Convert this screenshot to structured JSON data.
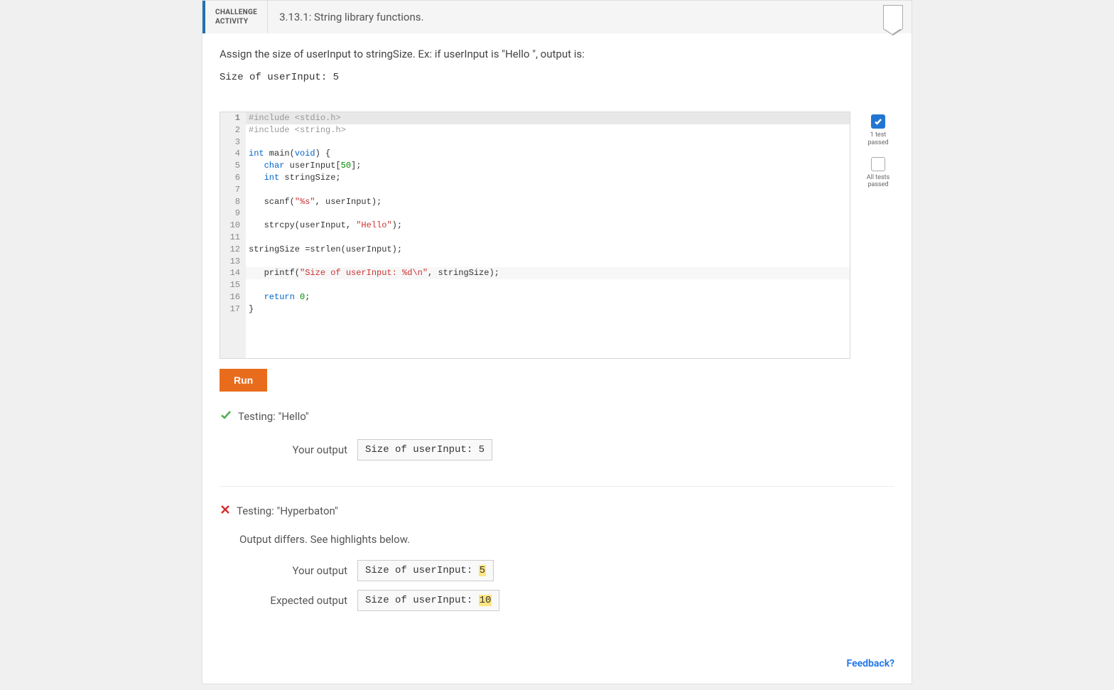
{
  "challenge": {
    "label1": "CHALLENGE",
    "label2": "ACTIVITY",
    "title": "3.13.1: String library functions."
  },
  "instruction": "Assign the size of userInput to stringSize. Ex: if userInput is \"Hello \", output is:",
  "example_output": "Size of userInput: 5",
  "code": {
    "lines": [
      {
        "n": "1",
        "active": true,
        "tokens": [
          {
            "t": "#include <stdio.h>",
            "c": "kw-pp"
          }
        ]
      },
      {
        "n": "2",
        "tokens": [
          {
            "t": "#include <string.h>",
            "c": "kw-pp"
          }
        ]
      },
      {
        "n": "3",
        "tokens": []
      },
      {
        "n": "4",
        "tokens": [
          {
            "t": "int",
            "c": "kw-type"
          },
          {
            "t": " main(",
            "c": ""
          },
          {
            "t": "void",
            "c": "kw-kw"
          },
          {
            "t": ") {",
            "c": ""
          }
        ]
      },
      {
        "n": "5",
        "tokens": [
          {
            "t": "   ",
            "c": ""
          },
          {
            "t": "char",
            "c": "kw-type"
          },
          {
            "t": " userInput[",
            "c": ""
          },
          {
            "t": "50",
            "c": "kw-num"
          },
          {
            "t": "];",
            "c": ""
          }
        ]
      },
      {
        "n": "6",
        "tokens": [
          {
            "t": "   ",
            "c": ""
          },
          {
            "t": "int",
            "c": "kw-type"
          },
          {
            "t": " stringSize;",
            "c": ""
          }
        ]
      },
      {
        "n": "7",
        "tokens": []
      },
      {
        "n": "8",
        "tokens": [
          {
            "t": "   scanf(",
            "c": ""
          },
          {
            "t": "\"%s\"",
            "c": "kw-str"
          },
          {
            "t": ", userInput);",
            "c": ""
          }
        ]
      },
      {
        "n": "9",
        "tokens": []
      },
      {
        "n": "10",
        "tokens": [
          {
            "t": "   strcpy(userInput, ",
            "c": ""
          },
          {
            "t": "\"Hello\"",
            "c": "kw-str"
          },
          {
            "t": ");",
            "c": ""
          }
        ]
      },
      {
        "n": "11",
        "tokens": []
      },
      {
        "n": "12",
        "tokens": [
          {
            "t": "stringSize =strlen(userInput);",
            "c": ""
          }
        ]
      },
      {
        "n": "13",
        "tokens": []
      },
      {
        "n": "14",
        "hl": true,
        "tokens": [
          {
            "t": "   printf(",
            "c": ""
          },
          {
            "t": "\"Size of userInput: %d\\n\"",
            "c": "kw-str"
          },
          {
            "t": ", stringSize);",
            "c": ""
          }
        ]
      },
      {
        "n": "15",
        "tokens": []
      },
      {
        "n": "16",
        "tokens": [
          {
            "t": "   ",
            "c": ""
          },
          {
            "t": "return",
            "c": "kw-kw"
          },
          {
            "t": " ",
            "c": ""
          },
          {
            "t": "0",
            "c": "kw-num"
          },
          {
            "t": ";",
            "c": ""
          }
        ]
      },
      {
        "n": "17",
        "tokens": [
          {
            "t": "}",
            "c": ""
          }
        ]
      }
    ]
  },
  "status": {
    "one_test": "1 test passed",
    "all_tests": "All tests passed"
  },
  "run_label": "Run",
  "tests": [
    {
      "pass": true,
      "title": "Testing: \"Hello\"",
      "outputs": [
        {
          "label": "Your output",
          "value": "Size of userInput: 5",
          "hl": ""
        }
      ]
    },
    {
      "pass": false,
      "title": "Testing: \"Hyperbaton\"",
      "diff_msg": "Output differs. See highlights below.",
      "outputs": [
        {
          "label": "Your output",
          "value_pre": "Size of userInput: ",
          "hl": "5"
        },
        {
          "label": "Expected output",
          "value_pre": "Size of userInput: ",
          "hl": "10"
        }
      ]
    }
  ],
  "feedback": "Feedback?"
}
